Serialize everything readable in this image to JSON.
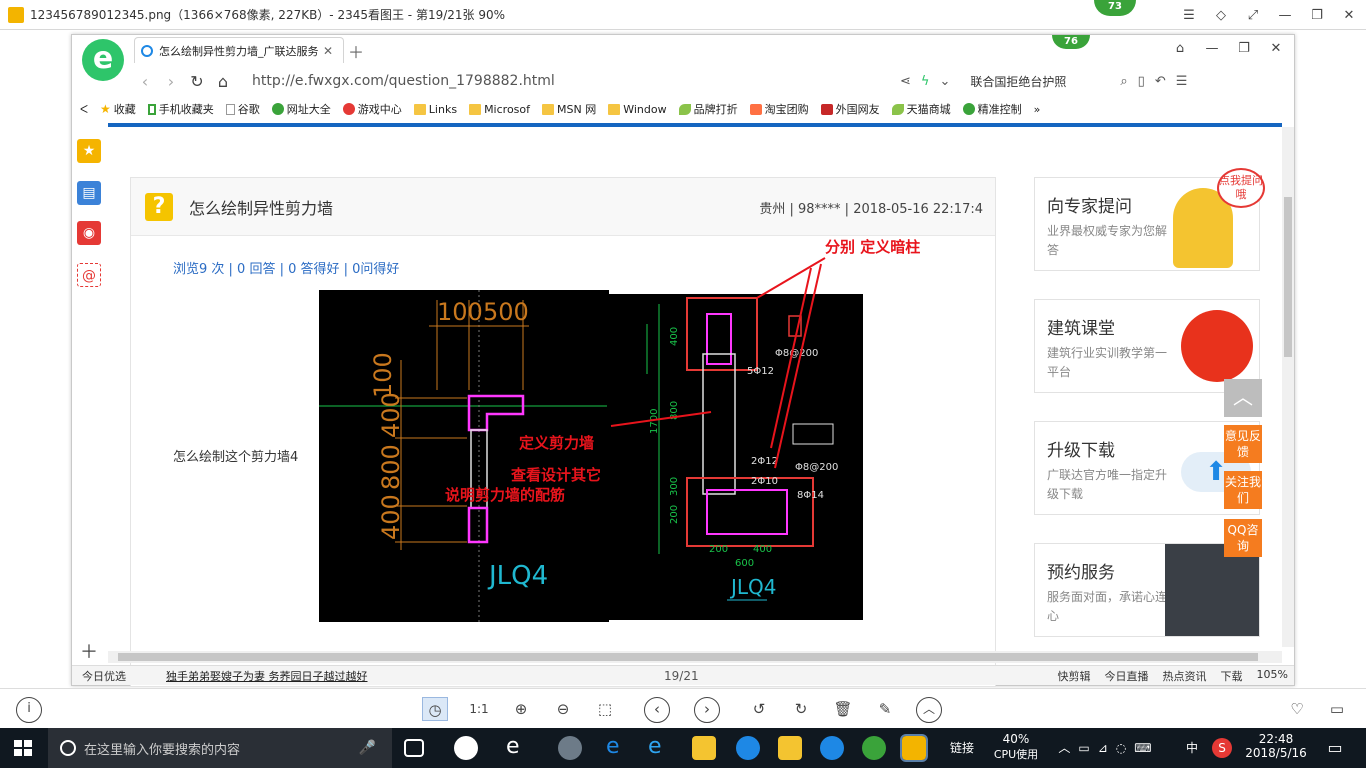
{
  "viewer": {
    "title": "123456789012345.png（1366×768像素, 227KB）- 2345看图王 - 第19/21张 90%",
    "badge": "73"
  },
  "browser": {
    "tab_title": "怎么绘制异性剪力墙_广联达服务",
    "badge": "76",
    "url": "http://e.fwxgx.com/question_1798882.html",
    "search_text": "联合国拒绝台护照",
    "bookmarks": [
      "收藏",
      "手机收藏夹",
      "谷歌",
      "网址大全",
      "游戏中心",
      "Links",
      "Microsof",
      "MSN 网",
      "Window",
      "品牌打折",
      "淘宝团购",
      "外国网友",
      "天猫商城",
      "精准控制"
    ]
  },
  "question": {
    "title": "怎么绘制异性剪力墙",
    "meta": "贵州 | 98**** | 2018-05-16 22:17:4",
    "stats": "浏览9 次 | 0 回答 | 0 答得好 | 0问得好",
    "text": "怎么绘制这个剪力墙4"
  },
  "cad": {
    "dims_top": [
      "100",
      "500"
    ],
    "dims_side": [
      "100",
      "400",
      "800",
      "400"
    ],
    "label_left": "JLQ4",
    "label_right": "JLQ4",
    "annotations": [
      "分别 定义暗柱",
      "定义剪力墙",
      "查看设计其它",
      "说明剪力墙的配筋"
    ],
    "right_dims": [
      "400",
      "1700",
      "800",
      "300",
      "200",
      "200",
      "400",
      "600"
    ],
    "rebar": [
      "Φ8@200",
      "5Φ12",
      "2Φ12",
      "Φ8@200",
      "2Φ10",
      "8Φ14"
    ]
  },
  "sidebar": {
    "ask_title": "向专家提问",
    "ask_sub": "业界最权威专家为您解答",
    "ask_bubble": "点我提问哦",
    "class_title": "建筑课堂",
    "class_sub": "建筑行业实训教学第一平台",
    "upgrade_title": "升级下载",
    "upgrade_sub": "广联达官方唯一指定升级下载",
    "service_title": "预约服务",
    "service_sub": "服务面对面，承诺心连心"
  },
  "float_buttons": [
    "意见反馈",
    "关注我们",
    "QQ咨询"
  ],
  "status": {
    "left1": "今日优选",
    "left2": "独手弟弟娶嫂子为妻 务荞园日子越过越好",
    "pager": "19/21",
    "items": [
      "快剪辑",
      "今日直播",
      "热点资讯",
      "下载",
      "105%"
    ]
  },
  "taskbar": {
    "search_placeholder": "在这里输入你要搜索的内容",
    "link": "链接",
    "cpu": "40%",
    "cpu_label": "CPU使用",
    "ime": "中",
    "time": "22:48",
    "date": "2018/5/16"
  }
}
